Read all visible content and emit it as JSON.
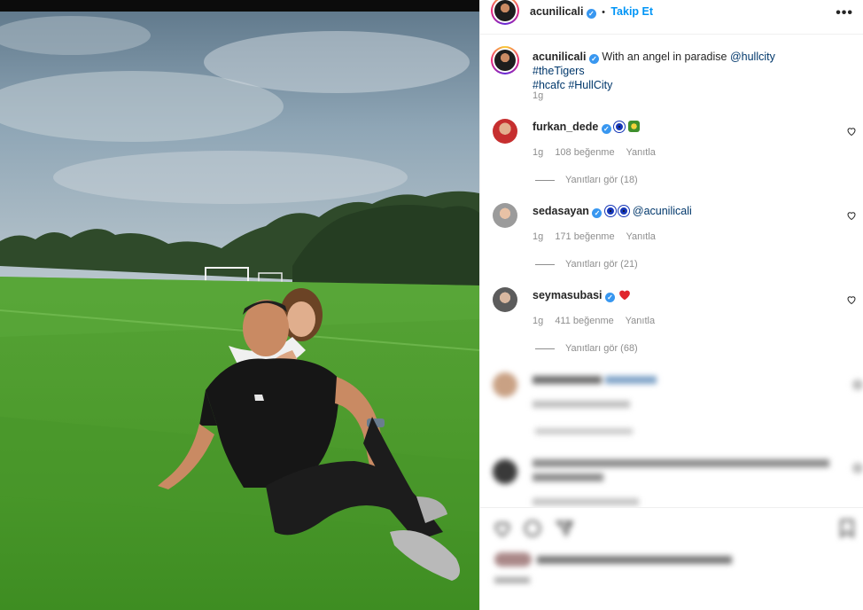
{
  "post": {
    "username": "acunilicali",
    "separator": "•",
    "follow_label": "Takip Et",
    "more_label": "•••",
    "caption_text": "With an angel in paradise",
    "caption_mention": "@hullcity",
    "caption_tags": [
      "#theTigers",
      "#hcafc",
      "#HullCity"
    ],
    "caption_time": "1g"
  },
  "comments": [
    {
      "username": "furkan_dede",
      "time": "1g",
      "likes": "108 beğenme",
      "reply": "Yanıtla",
      "view_replies": "Yanıtları gör (18)"
    },
    {
      "username": "sedasayan",
      "mention": "@acunilicali",
      "time": "1g",
      "likes": "171 beğenme",
      "reply": "Yanıtla",
      "view_replies": "Yanıtları gör (21)"
    },
    {
      "username": "seymasubasi",
      "time": "1g",
      "likes": "411 beğenme",
      "reply": "Yanıtla",
      "view_replies": "Yanıtları gör (68)"
    }
  ],
  "icons": [
    "verified-badge-icon",
    "heart-icon",
    "more-options-icon",
    "like-icon",
    "comment-icon",
    "share-icon",
    "save-icon"
  ],
  "colors": {
    "accent": "#0095f6",
    "verified": "#3897f0",
    "link": "#00376b",
    "muted": "#8e8e8e"
  }
}
